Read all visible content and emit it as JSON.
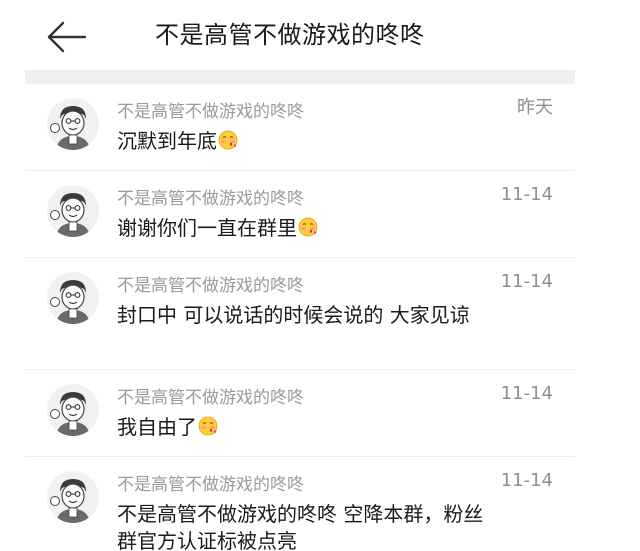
{
  "header": {
    "back_icon": "arrow-left-icon",
    "title": "不是高管不做游戏的咚咚"
  },
  "messages": [
    {
      "sender": "不是高管不做游戏的咚咚",
      "time": "昨天",
      "text": "沉默到年底",
      "emoji": "blush-kiss-emoji-icon"
    },
    {
      "sender": "不是高管不做游戏的咚咚",
      "time": "11-14",
      "text": "谢谢你们一直在群里",
      "emoji": "blush-kiss-emoji-icon"
    },
    {
      "sender": "不是高管不做游戏的咚咚",
      "time": "11-14",
      "text": "封口中 可以说话的时候会说的 大家见谅",
      "emoji": ""
    },
    {
      "sender": "不是高管不做游戏的咚咚",
      "time": "11-14",
      "text": "我自由了",
      "emoji": "blush-kiss-emoji-icon"
    },
    {
      "sender": "不是高管不做游戏的咚咚",
      "time": "11-14",
      "text": "不是高管不做游戏的咚咚 空降本群，粉丝群官方认证标被点亮",
      "emoji": ""
    }
  ],
  "colors": {
    "divider": "#efefef",
    "sender_name": "#9a9a9a",
    "message_text": "#1a1a1a",
    "timestamp": "#8f8f8f"
  }
}
